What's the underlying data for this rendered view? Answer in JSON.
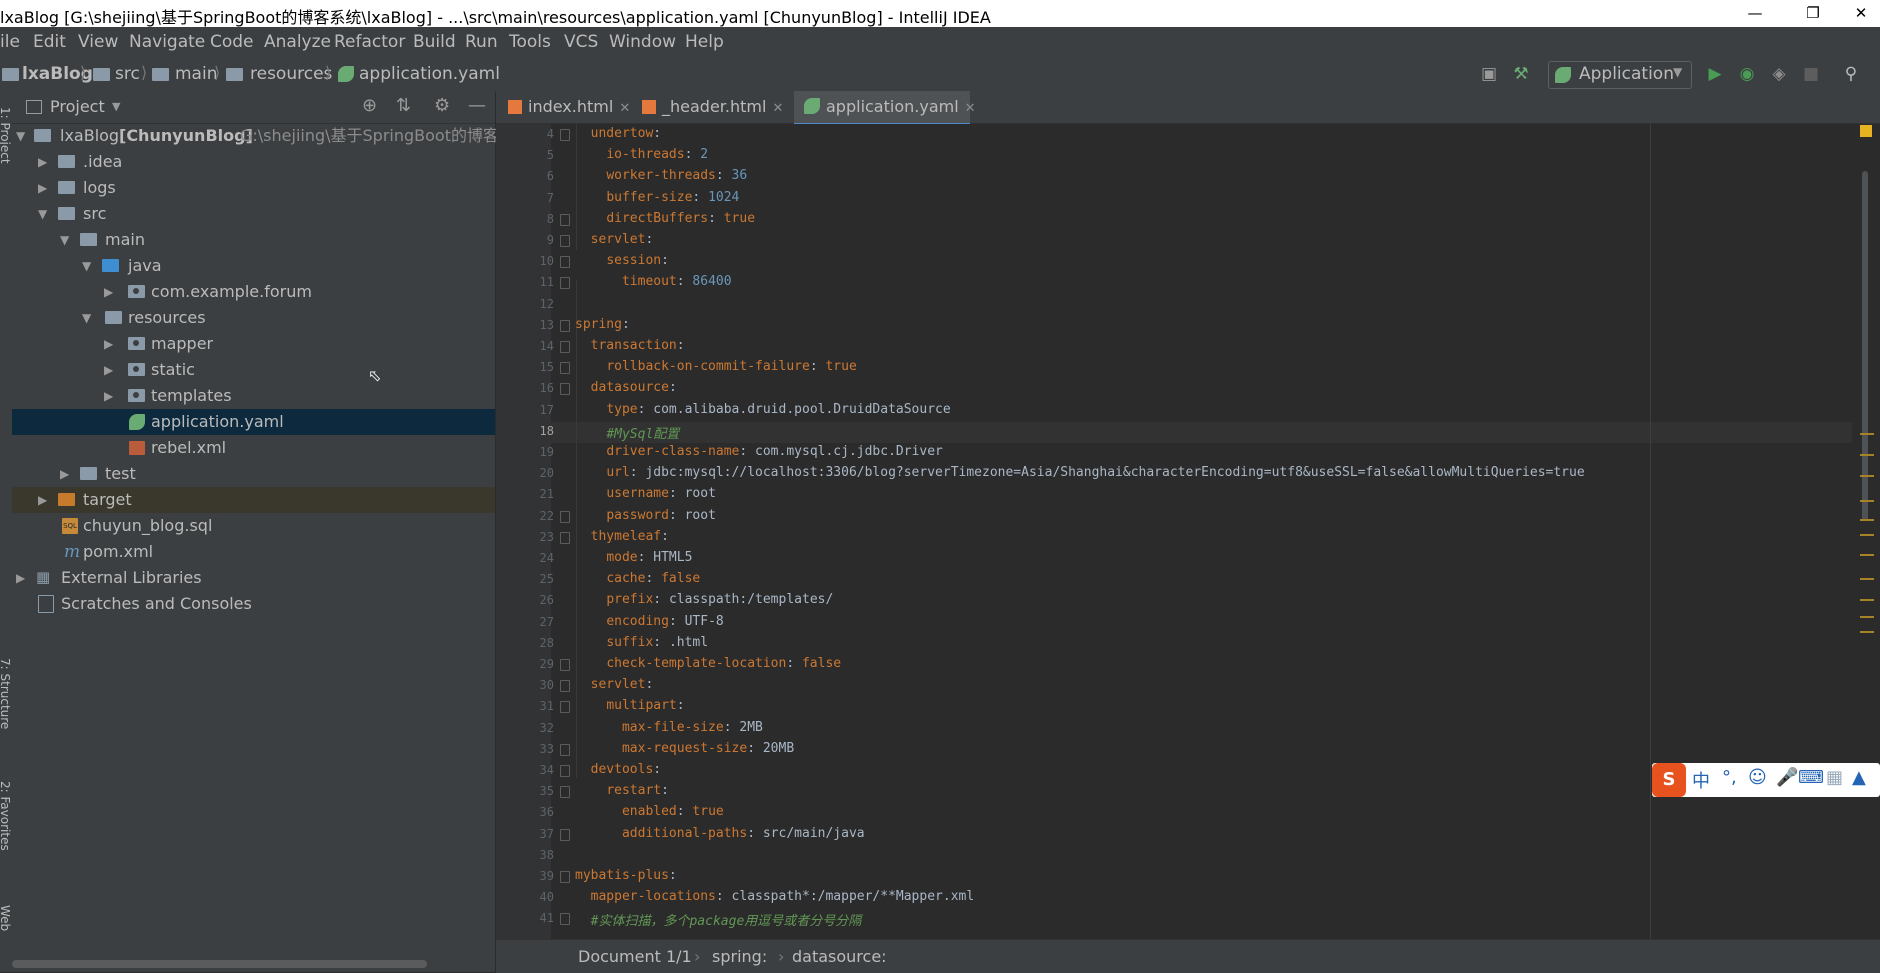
{
  "window": {
    "title": "lxaBlog [G:\\shejiing\\基于SpringBoot的博客系统\\lxaBlog] - ...\\src\\main\\resources\\application.yaml [ChunyunBlog] - IntelliJ IDEA"
  },
  "menu": [
    "ile",
    "Edit",
    "View",
    "Navigate",
    "Code",
    "Analyze",
    "Refactor",
    "Build",
    "Run",
    "Tools",
    "VCS",
    "Window",
    "Help"
  ],
  "breadcrumb": [
    "lxaBlog",
    "src",
    "main",
    "resources",
    "application.yaml"
  ],
  "toolbar": {
    "run_config": "Application"
  },
  "sidebar": {
    "project_label": "1: Project",
    "structure_label": "7: Structure",
    "favorites_label": "2: Favorites",
    "web_label": "Web"
  },
  "project": {
    "header": "Project",
    "root_name": "lxaBlog",
    "root_module": "[ChunyunBlog]",
    "root_path": "G:\\shejiing\\基于SpringBoot的博客系",
    "items": [
      ".idea",
      "logs",
      "src",
      "main",
      "java",
      "com.example.forum",
      "resources",
      "mapper",
      "static",
      "templates",
      "application.yaml",
      "rebel.xml",
      "test",
      "target",
      "chuyun_blog.sql",
      "pom.xml",
      "External Libraries",
      "Scratches and Consoles"
    ]
  },
  "tabs": [
    "index.html",
    "_header.html",
    "application.yaml"
  ],
  "editor": {
    "line_numbers": [
      "4",
      "5",
      "6",
      "7",
      "8",
      "9",
      "10",
      "11",
      "12",
      "13",
      "14",
      "15",
      "16",
      "17",
      "18",
      "19",
      "20",
      "21",
      "22",
      "23",
      "24",
      "25",
      "26",
      "27",
      "28",
      "29",
      "30",
      "31",
      "32",
      "33",
      "34",
      "35",
      "36",
      "37",
      "38",
      "39",
      "40",
      "41"
    ],
    "current_line": "18",
    "lines": [
      {
        "indent": "  ",
        "key": "undertow",
        "sep": ":",
        "val": ""
      },
      {
        "indent": "    ",
        "key": "io-threads",
        "sep": ": ",
        "val": "2"
      },
      {
        "indent": "    ",
        "key": "worker-threads",
        "sep": ": ",
        "val": "36"
      },
      {
        "indent": "    ",
        "key": "buffer-size",
        "sep": ": ",
        "val": "1024"
      },
      {
        "indent": "    ",
        "key": "directBuffers",
        "sep": ": ",
        "val": "true"
      },
      {
        "indent": "  ",
        "key": "servlet",
        "sep": ":",
        "val": ""
      },
      {
        "indent": "    ",
        "key": "session",
        "sep": ":",
        "val": ""
      },
      {
        "indent": "      ",
        "key": "timeout",
        "sep": ": ",
        "val": "86400"
      },
      {
        "indent": "",
        "key": "",
        "sep": "",
        "val": ""
      },
      {
        "indent": "",
        "key": "spring",
        "sep": ":",
        "val": ""
      },
      {
        "indent": "  ",
        "key": "transaction",
        "sep": ":",
        "val": ""
      },
      {
        "indent": "    ",
        "key": "rollback-on-commit-failure",
        "sep": ": ",
        "val": "true"
      },
      {
        "indent": "  ",
        "key": "datasource",
        "sep": ":",
        "val": ""
      },
      {
        "indent": "    ",
        "key": "type",
        "sep": ": ",
        "val": "com.alibaba.druid.pool.DruidDataSource"
      },
      {
        "indent": "    ",
        "key": "",
        "sep": "",
        "val": "",
        "comment": "#MySql配置"
      },
      {
        "indent": "    ",
        "key": "driver-class-name",
        "sep": ": ",
        "val": "com.mysql.cj.jdbc.Driver"
      },
      {
        "indent": "    ",
        "key": "url",
        "sep": ": ",
        "val": "jdbc:mysql://localhost:3306/blog?serverTimezone=Asia/Shanghai&characterEncoding=utf8&useSSL=false&allowMultiQueries=true"
      },
      {
        "indent": "    ",
        "key": "username",
        "sep": ": ",
        "val": "root"
      },
      {
        "indent": "    ",
        "key": "password",
        "sep": ": ",
        "val": "root"
      },
      {
        "indent": "  ",
        "key": "thymeleaf",
        "sep": ":",
        "val": ""
      },
      {
        "indent": "    ",
        "key": "mode",
        "sep": ": ",
        "val": "HTML5"
      },
      {
        "indent": "    ",
        "key": "cache",
        "sep": ": ",
        "val": "false"
      },
      {
        "indent": "    ",
        "key": "prefix",
        "sep": ": ",
        "val": "classpath:/templates/"
      },
      {
        "indent": "    ",
        "key": "encoding",
        "sep": ": ",
        "val": "UTF-8"
      },
      {
        "indent": "    ",
        "key": "suffix",
        "sep": ": ",
        "val": ".html"
      },
      {
        "indent": "    ",
        "key": "check-template-location",
        "sep": ": ",
        "val": "false"
      },
      {
        "indent": "  ",
        "key": "servlet",
        "sep": ":",
        "val": ""
      },
      {
        "indent": "    ",
        "key": "multipart",
        "sep": ":",
        "val": ""
      },
      {
        "indent": "      ",
        "key": "max-file-size",
        "sep": ": ",
        "val": "2MB"
      },
      {
        "indent": "      ",
        "key": "max-request-size",
        "sep": ": ",
        "val": "20MB"
      },
      {
        "indent": "  ",
        "key": "devtools",
        "sep": ":",
        "val": ""
      },
      {
        "indent": "    ",
        "key": "restart",
        "sep": ":",
        "val": ""
      },
      {
        "indent": "      ",
        "key": "enabled",
        "sep": ": ",
        "val": "true"
      },
      {
        "indent": "      ",
        "key": "additional-paths",
        "sep": ": ",
        "val": "src/main/java"
      },
      {
        "indent": "",
        "key": "",
        "sep": "",
        "val": ""
      },
      {
        "indent": "",
        "key": "mybatis-plus",
        "sep": ":",
        "val": ""
      },
      {
        "indent": "  ",
        "key": "mapper-locations",
        "sep": ": ",
        "val": "classpath*:/mapper/**Mapper.xml"
      },
      {
        "indent": "  ",
        "key": "",
        "sep": "",
        "val": "",
        "comment": "#实体扫描，多个package用逗号或者分号分隔"
      }
    ]
  },
  "statusbar": {
    "document": "Document 1/1",
    "path1": "spring:",
    "path2": "datasource:"
  },
  "ime": {
    "logo": "S",
    "mode": "中",
    "punct": "°,"
  },
  "colors": {
    "key": "#cc7832",
    "value": "#a9b7c6",
    "number": "#6897bb",
    "comment": "#629755",
    "selection": "#0d293e",
    "accent": "#4a88c7"
  }
}
